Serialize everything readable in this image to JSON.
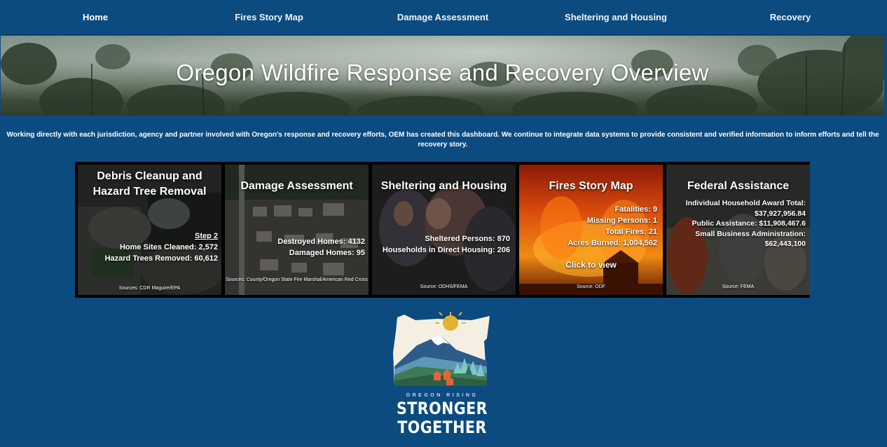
{
  "nav": {
    "items": [
      "Home",
      "Fires Story Map",
      "Damage Assessment",
      "Sheltering and Housing",
      "Recovery"
    ]
  },
  "banner": {
    "title": "Oregon Wildfire Response and Recovery Overview"
  },
  "intro": {
    "text": "Working directly with each jurisdiction, agency and partner involved with Oregon's response and recovery efforts, OEM has created this dashboard. We continue to integrate data systems to provide consistent and verified information to inform efforts and tell the recovery story."
  },
  "cards": {
    "debris": {
      "title": "Debris Cleanup and Hazard Tree Removal",
      "step": "Step 2",
      "line1": "Home Sites Cleaned: 2,572",
      "line2": "Hazard Trees Removed: 60,612",
      "source": "Sources: CDR Maguire/EPA"
    },
    "damage": {
      "title": "Damage Assessment",
      "line1": "Destroyed Homes: 4132",
      "line2": "Damaged Homes: 95",
      "source": "Sources: County/Oregon State Fire Marshal/American Red Cross"
    },
    "sheltering": {
      "title": "Sheltering and Housing",
      "line1": "Sheltered Persons: 870",
      "line2": "Households in Direct Housing: 206",
      "source": "Source: ODHS/FEMA"
    },
    "fires": {
      "title": "Fires Story Map",
      "line1": "Fatalities:  9",
      "line2": "Missing Persons: 1",
      "line3": "Total Fires: 21",
      "line4": "Acres Burned: 1,004,562",
      "cta": "Click to view",
      "source": "Source: ODF"
    },
    "federal": {
      "title": "Federal Assistance",
      "line1": "Individual Household Award Total:",
      "line2": "$37,927,956.84",
      "line3": "Public Assistance: $11,908,467.6",
      "line4": "Small Business Administration:",
      "line5": "$62,443,100",
      "source": "Source: FEMA"
    }
  },
  "logo": {
    "tagline": "OREGON RISING",
    "word1": "STRONGER",
    "word2": "TOGETHER"
  },
  "colors": {
    "page_bg": "#0c4b80",
    "text": "#ffffff",
    "card_frame": "#000000"
  }
}
